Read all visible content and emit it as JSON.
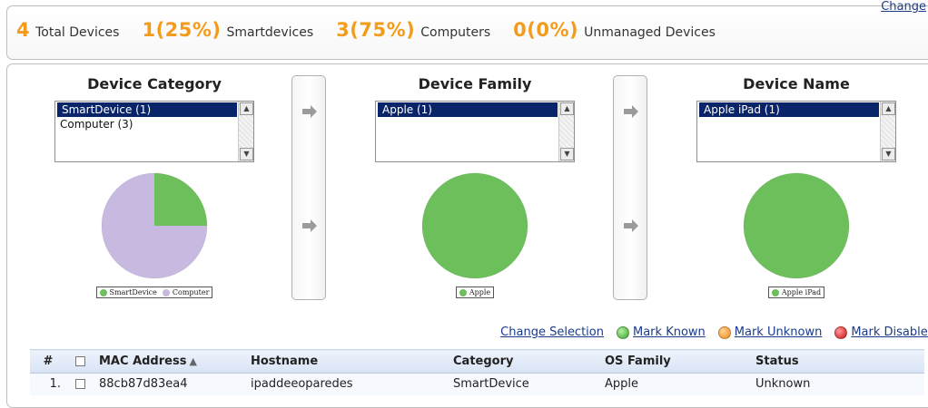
{
  "summary": {
    "total": {
      "num": "4",
      "label": "Total Devices"
    },
    "smart": {
      "num": "1(25%)",
      "label": "Smartdevices"
    },
    "computers": {
      "num": "3(75%)",
      "label": "Computers"
    },
    "unmanaged": {
      "num": "0(0%)",
      "label": "Unmanaged Devices"
    },
    "change_link": "Change"
  },
  "columns": [
    {
      "title": "Device Category",
      "options": [
        "SmartDevice (1)",
        "Computer (3)"
      ],
      "selected": "SmartDevice (1)",
      "legend": [
        "SmartDevice",
        "Computer"
      ]
    },
    {
      "title": "Device Family",
      "options": [
        "Apple (1)"
      ],
      "selected": "Apple (1)",
      "legend": [
        "Apple"
      ]
    },
    {
      "title": "Device Name",
      "options": [
        "Apple iPad (1)"
      ],
      "selected": "Apple iPad (1)",
      "legend": [
        "Apple iPad"
      ]
    }
  ],
  "colors": {
    "pie_green": "#6cbf5a",
    "pie_lilac": "#c7b9df",
    "accent_orange": "#f39c1b",
    "link_blue": "#1a3a8a",
    "status_red": "#d40000"
  },
  "chart_data": [
    {
      "type": "pie",
      "categories": [
        "SmartDevice",
        "Computer"
      ],
      "values": [
        1,
        3
      ]
    },
    {
      "type": "pie",
      "categories": [
        "Apple"
      ],
      "values": [
        1
      ]
    },
    {
      "type": "pie",
      "categories": [
        "Apple iPad"
      ],
      "values": [
        1
      ]
    }
  ],
  "actions": {
    "change_selection": "Change Selection",
    "mark_known": "Mark Known",
    "mark_unknown": "Mark Unknown",
    "mark_disabled": "Mark Disabled"
  },
  "table": {
    "headers": {
      "idx": "#",
      "mac": "MAC Address",
      "hostname": "Hostname",
      "category": "Category",
      "os": "OS Family",
      "status": "Status"
    },
    "sort_indicator": "▲",
    "rows": [
      {
        "idx": "1.",
        "mac": "88cb87d83ea4",
        "hostname": "ipaddeeoparedes",
        "category": "SmartDevice",
        "os": "Apple",
        "status": "Unknown"
      }
    ]
  }
}
